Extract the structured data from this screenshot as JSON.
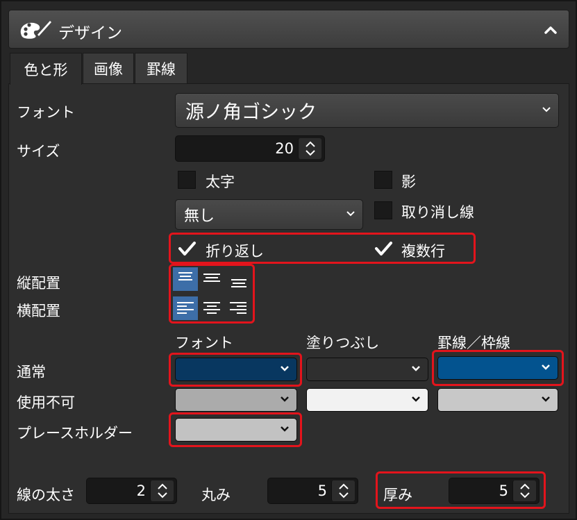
{
  "panel": {
    "title": "デザイン",
    "icons": {
      "header": "palette-icon",
      "collapse": "chevron-up-icon"
    }
  },
  "tabs": [
    {
      "label": "色と形",
      "active": true
    },
    {
      "label": "画像",
      "active": false
    },
    {
      "label": "罫線",
      "active": false
    }
  ],
  "font": {
    "label": "フォント",
    "value": "源ノ角ゴシック"
  },
  "size": {
    "label": "サイズ",
    "value": "20"
  },
  "checkboxes": {
    "bold": {
      "label": "太字",
      "checked": false
    },
    "shadow": {
      "label": "影",
      "checked": false
    },
    "strike": {
      "label": "取り消し線",
      "checked": false
    },
    "wrap": {
      "label": "折り返し",
      "checked": true
    },
    "multiline": {
      "label": "複数行",
      "checked": true
    }
  },
  "underline": {
    "value": "無し"
  },
  "alignment": {
    "vertical_label": "縦配置",
    "horizontal_label": "横配置"
  },
  "colors": {
    "headers": {
      "font": "フォント",
      "fill": "塗りつぶし",
      "border": "罫線／枠線"
    },
    "rows": [
      {
        "label": "通常",
        "font": "#083760",
        "fill": "#2f2f2f",
        "border": "#03538f"
      },
      {
        "label": "使用不可",
        "font": "#ababab",
        "fill": "#f2f2f2",
        "border": "#c8c8c8"
      },
      {
        "label": "プレースホルダー",
        "font": "#c2c2c2"
      }
    ]
  },
  "bottom": {
    "line_width": {
      "label": "線の太さ",
      "value": "2"
    },
    "roundness": {
      "label": "丸み",
      "value": "5"
    },
    "thickness": {
      "label": "厚み",
      "value": "5"
    }
  },
  "accent": {
    "selected": "#3d6ea8",
    "highlight": "#e3141c"
  }
}
